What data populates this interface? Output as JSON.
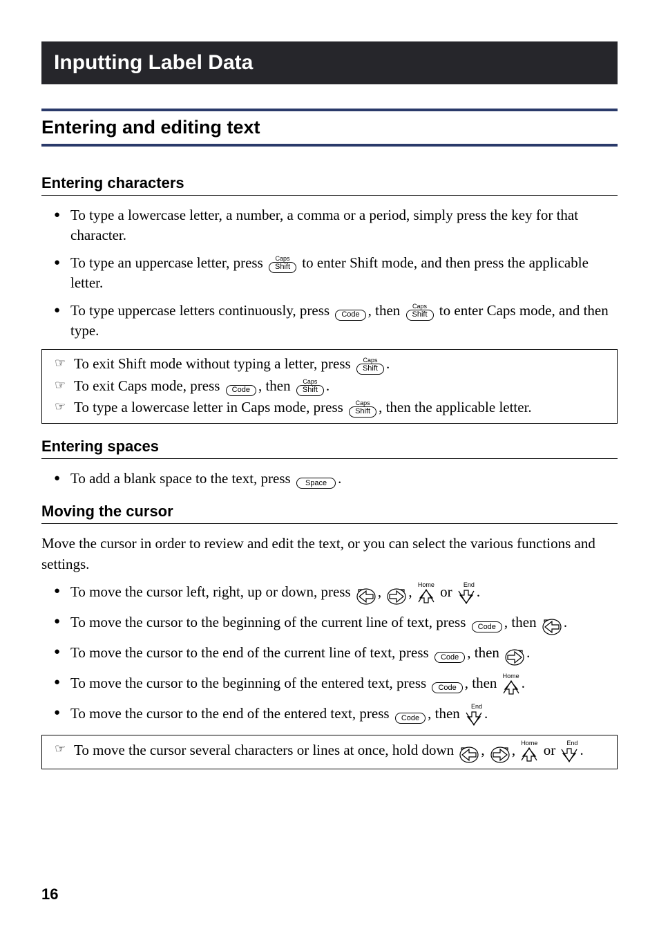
{
  "page_number": "16",
  "banner": "Inputting Label Data",
  "subhead": "Entering and editing text",
  "keys": {
    "shift": "Shift",
    "shift_caption": "Caps",
    "code": "Code",
    "space": "Space",
    "up_caption": "Home",
    "down_caption": "End"
  },
  "s1": {
    "title": "Entering characters",
    "b1": "To type a lowercase letter, a number, a comma or a period, simply press the key for that character.",
    "b2a": "To type an uppercase letter, press ",
    "b2b": " to enter Shift mode, and then press the applicable letter.",
    "b3a": "To type uppercase letters continuously, press ",
    "b3b": ", then ",
    "b3c": " to enter Caps mode, and then type.",
    "n1a": "To exit Shift mode without typing a letter, press ",
    "n1b": ".",
    "n2a": "To exit Caps mode, press ",
    "n2b": ", then ",
    "n2c": ".",
    "n3a": "To type a lowercase letter in Caps mode, press ",
    "n3b": ", then the applicable letter."
  },
  "s2": {
    "title": "Entering spaces",
    "b1a": "To add a blank space to the text, press ",
    "b1b": "."
  },
  "s3": {
    "title": "Moving the cursor",
    "intro": "Move the cursor in order to review and edit the text, or you can select the various functions and settings.",
    "b1a": "To move the cursor left, right, up or down, press ",
    "b1b": ", ",
    "b1c": ", ",
    "b1d": " or ",
    "b1e": ".",
    "b2a": "To move the cursor to the beginning of the current line of text, press ",
    "b2b": ", then ",
    "b2c": ".",
    "b3a": "To move the cursor to the end of the current line of text, press ",
    "b3b": ", then ",
    "b3c": ".",
    "b4a": "To move the cursor to the beginning of the entered text, press ",
    "b4b": ", then ",
    "b4c": ".",
    "b5a": "To move the cursor to the end of the entered text, press ",
    "b5b": ", then ",
    "b5c": ".",
    "n1a": "To move the cursor several characters or lines at once, hold down ",
    "n1b": ", ",
    "n1c": ", ",
    "n1d": " or ",
    "n1e": "."
  }
}
